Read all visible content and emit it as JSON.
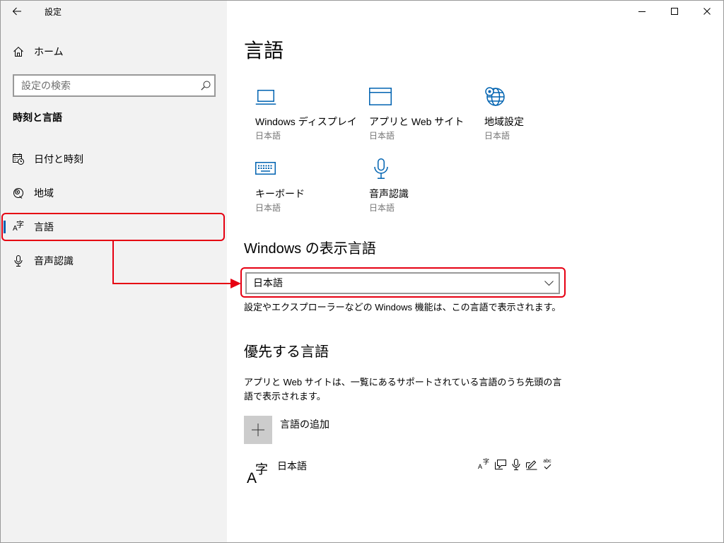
{
  "window": {
    "title": "設定",
    "back_icon": "back-arrow-icon",
    "controls": [
      "minimize-icon",
      "maximize-icon",
      "close-icon"
    ]
  },
  "colors": {
    "accent": "#0063b1",
    "sidebar_bg": "#f2f2f2",
    "highlight": "#e60012",
    "add_tile_bg": "#cccccc",
    "secondary_text": "#767676"
  },
  "sidebar": {
    "home": {
      "label": "ホーム",
      "icon": "home-icon"
    },
    "search": {
      "placeholder": "設定の検索",
      "value": "",
      "icon": "search-icon"
    },
    "section_title": "時刻と言語",
    "items": [
      {
        "label": "日付と時刻",
        "icon": "calendar-clock-icon",
        "selected": false
      },
      {
        "label": "地域",
        "icon": "region-icon",
        "selected": false
      },
      {
        "label": "言語",
        "icon": "language-icon",
        "selected": true
      },
      {
        "label": "音声認識",
        "icon": "microphone-icon",
        "selected": false
      }
    ]
  },
  "main": {
    "title": "言語",
    "tiles": [
      {
        "label": "Windows ディスプレイ",
        "sub": "日本語",
        "icon": "laptop-icon"
      },
      {
        "label": "アプリと Web サイト",
        "sub": "日本語",
        "icon": "browser-window-icon"
      },
      {
        "label": "地域設定",
        "sub": "日本語",
        "icon": "globe-icon"
      },
      {
        "label": "キーボード",
        "sub": "日本語",
        "icon": "keyboard-icon"
      },
      {
        "label": "音声認識",
        "sub": "日本語",
        "icon": "microphone-icon"
      }
    ],
    "display_language": {
      "heading": "Windows の表示言語",
      "selected": "日本語",
      "description": "設定やエクスプローラーなどの Windows 機能は、この言語で表示されます。"
    },
    "preferred_languages": {
      "heading": "優先する言語",
      "description": "アプリと Web サイトは、一覧にあるサポートされている言語のうち先頭の言語で表示されます。",
      "add_label": "言語の追加",
      "add_icon": "plus-icon",
      "languages": [
        {
          "name": "日本語",
          "icon": "language-icon",
          "features": [
            "language-pack-icon",
            "text-to-speech-icon",
            "speech-recognition-icon",
            "handwriting-icon",
            "spell-check-icon"
          ]
        }
      ]
    }
  },
  "icon_glyphs": {
    "language_latin": "A",
    "language_kanji": "字",
    "spell_check": "abc"
  }
}
